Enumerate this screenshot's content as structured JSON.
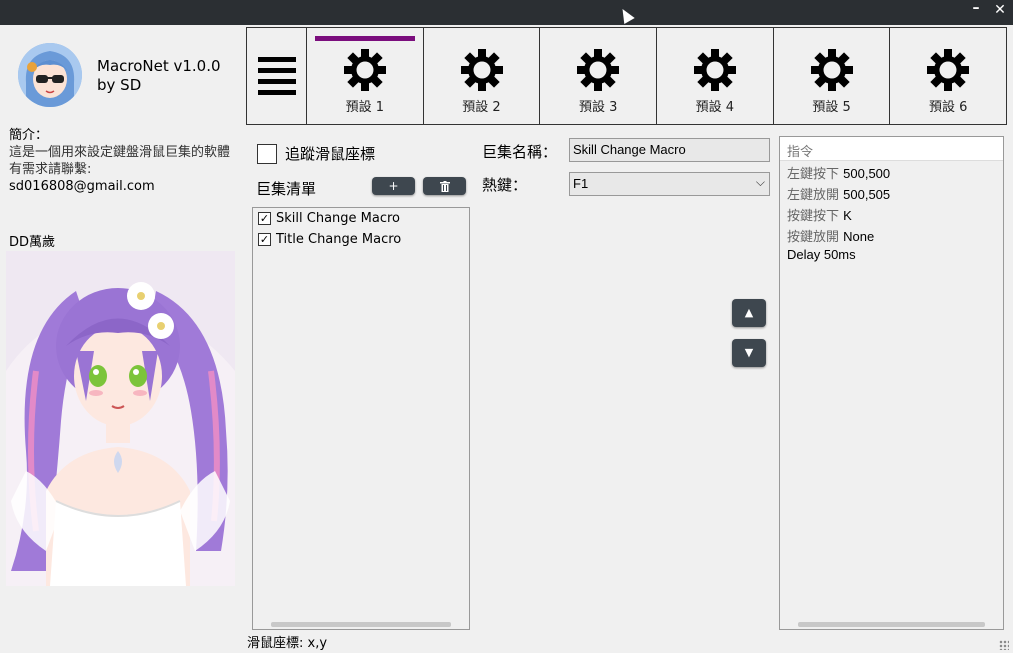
{
  "window": {
    "minimize": "–",
    "close": "✕"
  },
  "app": {
    "title": "MacroNet v1.0.0 by SD"
  },
  "sidebar": {
    "intro_heading": "簡介：",
    "intro_text": "這是一個用來設定鍵盤滑鼠巨集的軟體",
    "contact_label": "有需求請聯繫:",
    "contact_email": "sd016808@gmail.com",
    "dd_label": "DD萬歲"
  },
  "tabs": [
    {
      "label": "預設 1",
      "active": true
    },
    {
      "label": "預設 2",
      "active": false
    },
    {
      "label": "預設 3",
      "active": false
    },
    {
      "label": "預設 4",
      "active": false
    },
    {
      "label": "預設 5",
      "active": false
    },
    {
      "label": "預設 6",
      "active": false
    }
  ],
  "accent_color": "#7b0e7d",
  "macro_panel": {
    "track_label": "追蹤滑鼠座標",
    "list_label": "巨集清單",
    "add_label": "+",
    "delete_icon": "trash-icon",
    "items": [
      {
        "label": "Skill Change Macro",
        "checked": true
      },
      {
        "label": "Title Change Macro",
        "checked": true
      }
    ]
  },
  "form": {
    "name_label": "巨集名稱：",
    "name_value": "Skill Change Macro",
    "hotkey_label": "熱鍵：",
    "hotkey_value": "F1",
    "up_label": "▲",
    "down_label": "▼"
  },
  "commands": {
    "header": "指令",
    "rows": [
      {
        "cn": "左鍵按下",
        "val": "500,500"
      },
      {
        "cn": "左鍵放開",
        "val": "500,505"
      },
      {
        "cn": "按鍵按下",
        "val": "K"
      },
      {
        "cn": "按鍵放開",
        "val": "None"
      },
      {
        "cn": "",
        "val": "Delay 50ms"
      }
    ]
  },
  "status": {
    "label": "滑鼠座標:",
    "value": "x,y"
  }
}
